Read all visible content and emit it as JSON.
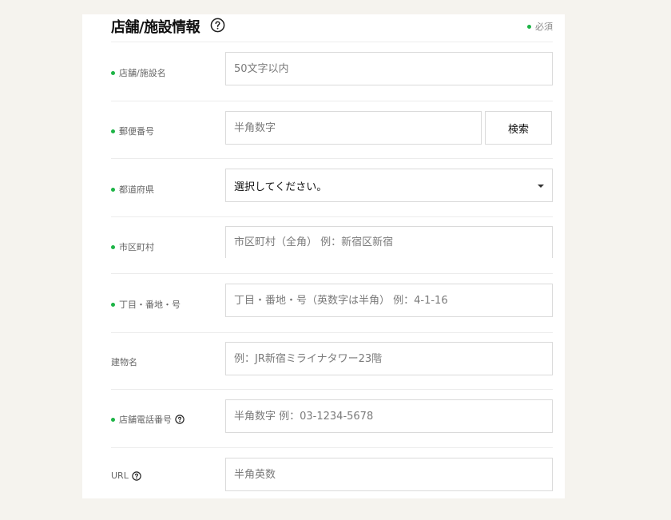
{
  "section": {
    "title": "店舗/施設情報",
    "required_label": "必須"
  },
  "colors": {
    "accent_dot": "#1db446",
    "border": "#dadada",
    "background": "#f5f3ee"
  },
  "fields": {
    "store_name": {
      "label": "店舗/施設名",
      "placeholder": "50文字以内",
      "required": true
    },
    "postal_code": {
      "label": "郵便番号",
      "placeholder": "半角数字",
      "required": true,
      "button_label": "検索"
    },
    "prefecture": {
      "label": "都道府県",
      "selected": "選択してください。",
      "required": true
    },
    "city": {
      "label": "市区町村",
      "placeholder": "市区町村（全角） 例：新宿区新宿",
      "required": true
    },
    "address": {
      "label": "丁目・番地・号",
      "placeholder": "丁目・番地・号（英数字は半角） 例：4-1-16",
      "required": true
    },
    "building": {
      "label": "建物名",
      "placeholder": "例：JR新宿ミライナタワー23階",
      "required": false
    },
    "phone": {
      "label": "店舗電話番号",
      "placeholder": "半角数字 例：03-1234-5678",
      "required": true
    },
    "url": {
      "label": "URL",
      "placeholder": "半角英数",
      "required": false
    }
  },
  "icons": {
    "help": "question-circle-icon",
    "dropdown": "caret-down-icon",
    "required": "green-dot-icon"
  }
}
